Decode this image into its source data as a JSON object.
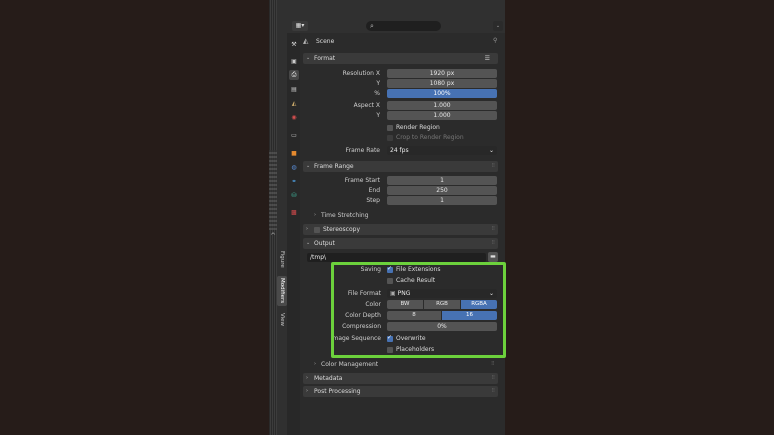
{
  "header": {
    "editor_type_icon": "properties-editor-icon",
    "search_icon": "⌕",
    "menu": "⌄"
  },
  "viewport_tabs": [
    "Figure",
    "Modifiers",
    "View"
  ],
  "scene": {
    "title": "Scene",
    "pin_icon": "pin-icon"
  },
  "format": {
    "title": "Format",
    "res_x_label": "Resolution X",
    "res_x": "1920 px",
    "res_y_label": "Y",
    "res_y": "1080 px",
    "res_pct_label": "%",
    "res_pct": "100%",
    "aspect_x_label": "Aspect X",
    "aspect_x": "1.000",
    "aspect_y_label": "Y",
    "aspect_y": "1.000",
    "render_region": "Render Region",
    "crop_region": "Crop to Render Region",
    "frame_rate_label": "Frame Rate",
    "frame_rate": "24 fps"
  },
  "frame_range": {
    "title": "Frame Range",
    "start_label": "Frame Start",
    "start": "1",
    "end_label": "End",
    "end": "250",
    "step_label": "Step",
    "step": "1",
    "time_stretching": "Time Stretching"
  },
  "stereoscopy": {
    "title": "Stereoscopy"
  },
  "output": {
    "title": "Output",
    "path": "/tmp\\",
    "saving_label": "Saving",
    "file_extensions": "File Extensions",
    "cache_result": "Cache Result",
    "file_format_label": "File Format",
    "file_format": "PNG",
    "color_label": "Color",
    "color_options": [
      "BW",
      "RGB",
      "RGBA"
    ],
    "color_selected": "RGBA",
    "color_depth_label": "Color Depth",
    "depth_options": [
      "8",
      "16"
    ],
    "depth_selected": "16",
    "compression_label": "Compression",
    "compression": "0%",
    "image_sequence_label": "Image Sequence",
    "overwrite": "Overwrite",
    "placeholders": "Placeholders",
    "color_management": "Color Management"
  },
  "metadata": {
    "title": "Metadata"
  },
  "post_processing": {
    "title": "Post Processing"
  },
  "colors": {
    "accent": "#4772b3",
    "highlight": "#6cd13c"
  }
}
